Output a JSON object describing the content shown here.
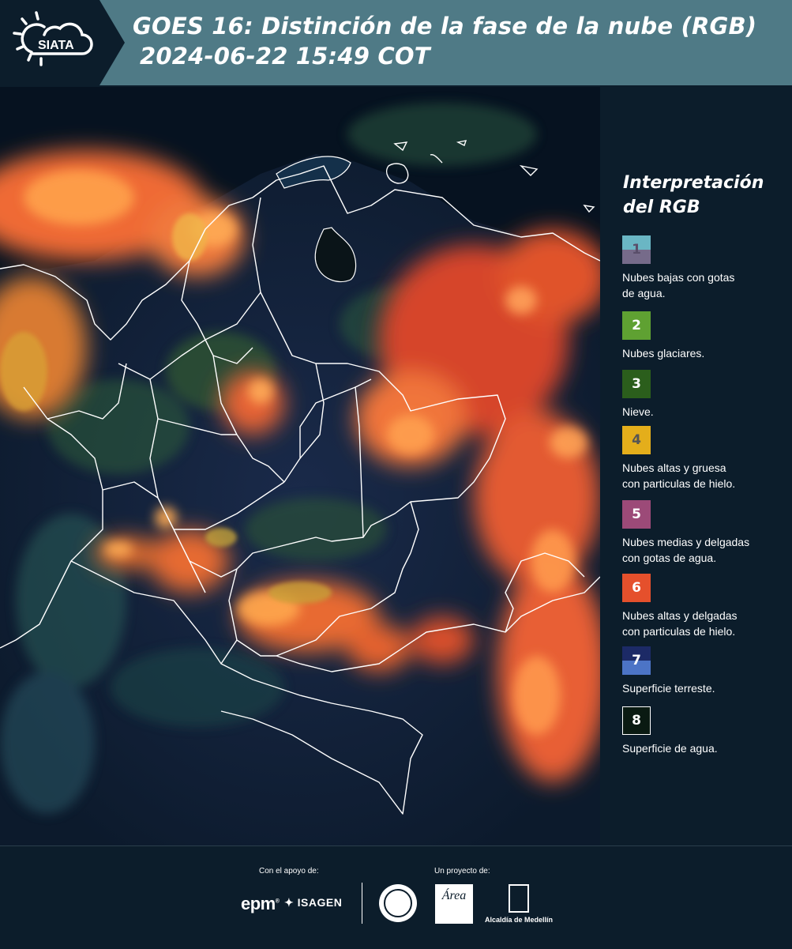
{
  "header": {
    "logo_text": "SIATA",
    "title_line1": "GOES 16: Distinción de la fase de la nube (RGB)",
    "title_line2": "2024-06-22 15:49 COT"
  },
  "legend": {
    "title_line1": "Interpretación",
    "title_line2": "del RGB",
    "items": [
      {
        "num": "1",
        "colors": [
          "#6ab6c4",
          "#766b8a"
        ],
        "num_color": "#5a4e6a",
        "label_lines": [
          "Nubes bajas con gotas",
          "de agua."
        ]
      },
      {
        "num": "2",
        "colors": [
          "#5fa132"
        ],
        "num_color": "#ffffff",
        "label_lines": [
          "Nubes glaciares."
        ]
      },
      {
        "num": "3",
        "colors": [
          "#2b5e1c"
        ],
        "num_color": "#ffffff",
        "label_lines": [
          "Nieve."
        ]
      },
      {
        "num": "4",
        "colors": [
          "#e4ae1b"
        ],
        "num_color": "#555555",
        "label_lines": [
          "Nubes altas y gruesa",
          "con particulas de hielo."
        ]
      },
      {
        "num": "5",
        "colors": [
          "#9c4a78"
        ],
        "num_color": "#ffffff",
        "label_lines": [
          "Nubes medias y delgadas",
          "con gotas de agua."
        ]
      },
      {
        "num": "6",
        "colors": [
          "#e5502c"
        ],
        "num_color": "#ffffff",
        "label_lines": [
          "Nubes altas y delgadas",
          "con particulas de hielo."
        ]
      },
      {
        "num": "7",
        "colors": [
          "#1c2a66",
          "#4c74c6"
        ],
        "num_color": "#ffffff",
        "label_lines": [
          "Superficie terreste."
        ]
      },
      {
        "num": "8",
        "colors": [
          "#0a1a12"
        ],
        "num_color": "#ffffff",
        "label_lines": [
          "Superficie de agua."
        ]
      }
    ]
  },
  "footer": {
    "support_label": "Con el apoyo de:",
    "project_label": "Un proyecto de:",
    "sponsor1": "epm",
    "sponsor2": "ISAGEN",
    "partner1_text": "Área",
    "partner2_name": "Alcaldía de Medellín"
  },
  "map_icons": [
    "sun-cloud-icon"
  ]
}
